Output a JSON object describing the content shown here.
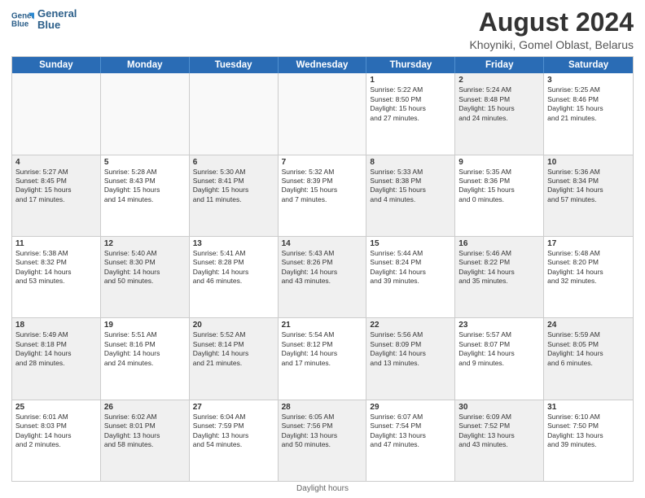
{
  "header": {
    "logo_line1": "General",
    "logo_line2": "Blue",
    "main_title": "August 2024",
    "subtitle": "Khoyniki, Gomel Oblast, Belarus"
  },
  "days_of_week": [
    "Sunday",
    "Monday",
    "Tuesday",
    "Wednesday",
    "Thursday",
    "Friday",
    "Saturday"
  ],
  "weeks": [
    [
      {
        "day": "",
        "info": "",
        "empty": true
      },
      {
        "day": "",
        "info": "",
        "empty": true
      },
      {
        "day": "",
        "info": "",
        "empty": true
      },
      {
        "day": "",
        "info": "",
        "empty": true
      },
      {
        "day": "1",
        "info": "Sunrise: 5:22 AM\nSunset: 8:50 PM\nDaylight: 15 hours\nand 27 minutes."
      },
      {
        "day": "2",
        "info": "Sunrise: 5:24 AM\nSunset: 8:48 PM\nDaylight: 15 hours\nand 24 minutes.",
        "shaded": true
      },
      {
        "day": "3",
        "info": "Sunrise: 5:25 AM\nSunset: 8:46 PM\nDaylight: 15 hours\nand 21 minutes."
      }
    ],
    [
      {
        "day": "4",
        "info": "Sunrise: 5:27 AM\nSunset: 8:45 PM\nDaylight: 15 hours\nand 17 minutes.",
        "shaded": true
      },
      {
        "day": "5",
        "info": "Sunrise: 5:28 AM\nSunset: 8:43 PM\nDaylight: 15 hours\nand 14 minutes."
      },
      {
        "day": "6",
        "info": "Sunrise: 5:30 AM\nSunset: 8:41 PM\nDaylight: 15 hours\nand 11 minutes.",
        "shaded": true
      },
      {
        "day": "7",
        "info": "Sunrise: 5:32 AM\nSunset: 8:39 PM\nDaylight: 15 hours\nand 7 minutes."
      },
      {
        "day": "8",
        "info": "Sunrise: 5:33 AM\nSunset: 8:38 PM\nDaylight: 15 hours\nand 4 minutes.",
        "shaded": true
      },
      {
        "day": "9",
        "info": "Sunrise: 5:35 AM\nSunset: 8:36 PM\nDaylight: 15 hours\nand 0 minutes."
      },
      {
        "day": "10",
        "info": "Sunrise: 5:36 AM\nSunset: 8:34 PM\nDaylight: 14 hours\nand 57 minutes.",
        "shaded": true
      }
    ],
    [
      {
        "day": "11",
        "info": "Sunrise: 5:38 AM\nSunset: 8:32 PM\nDaylight: 14 hours\nand 53 minutes."
      },
      {
        "day": "12",
        "info": "Sunrise: 5:40 AM\nSunset: 8:30 PM\nDaylight: 14 hours\nand 50 minutes.",
        "shaded": true
      },
      {
        "day": "13",
        "info": "Sunrise: 5:41 AM\nSunset: 8:28 PM\nDaylight: 14 hours\nand 46 minutes."
      },
      {
        "day": "14",
        "info": "Sunrise: 5:43 AM\nSunset: 8:26 PM\nDaylight: 14 hours\nand 43 minutes.",
        "shaded": true
      },
      {
        "day": "15",
        "info": "Sunrise: 5:44 AM\nSunset: 8:24 PM\nDaylight: 14 hours\nand 39 minutes."
      },
      {
        "day": "16",
        "info": "Sunrise: 5:46 AM\nSunset: 8:22 PM\nDaylight: 14 hours\nand 35 minutes.",
        "shaded": true
      },
      {
        "day": "17",
        "info": "Sunrise: 5:48 AM\nSunset: 8:20 PM\nDaylight: 14 hours\nand 32 minutes."
      }
    ],
    [
      {
        "day": "18",
        "info": "Sunrise: 5:49 AM\nSunset: 8:18 PM\nDaylight: 14 hours\nand 28 minutes.",
        "shaded": true
      },
      {
        "day": "19",
        "info": "Sunrise: 5:51 AM\nSunset: 8:16 PM\nDaylight: 14 hours\nand 24 minutes."
      },
      {
        "day": "20",
        "info": "Sunrise: 5:52 AM\nSunset: 8:14 PM\nDaylight: 14 hours\nand 21 minutes.",
        "shaded": true
      },
      {
        "day": "21",
        "info": "Sunrise: 5:54 AM\nSunset: 8:12 PM\nDaylight: 14 hours\nand 17 minutes."
      },
      {
        "day": "22",
        "info": "Sunrise: 5:56 AM\nSunset: 8:09 PM\nDaylight: 14 hours\nand 13 minutes.",
        "shaded": true
      },
      {
        "day": "23",
        "info": "Sunrise: 5:57 AM\nSunset: 8:07 PM\nDaylight: 14 hours\nand 9 minutes."
      },
      {
        "day": "24",
        "info": "Sunrise: 5:59 AM\nSunset: 8:05 PM\nDaylight: 14 hours\nand 6 minutes.",
        "shaded": true
      }
    ],
    [
      {
        "day": "25",
        "info": "Sunrise: 6:01 AM\nSunset: 8:03 PM\nDaylight: 14 hours\nand 2 minutes."
      },
      {
        "day": "26",
        "info": "Sunrise: 6:02 AM\nSunset: 8:01 PM\nDaylight: 13 hours\nand 58 minutes.",
        "shaded": true
      },
      {
        "day": "27",
        "info": "Sunrise: 6:04 AM\nSunset: 7:59 PM\nDaylight: 13 hours\nand 54 minutes."
      },
      {
        "day": "28",
        "info": "Sunrise: 6:05 AM\nSunset: 7:56 PM\nDaylight: 13 hours\nand 50 minutes.",
        "shaded": true
      },
      {
        "day": "29",
        "info": "Sunrise: 6:07 AM\nSunset: 7:54 PM\nDaylight: 13 hours\nand 47 minutes."
      },
      {
        "day": "30",
        "info": "Sunrise: 6:09 AM\nSunset: 7:52 PM\nDaylight: 13 hours\nand 43 minutes.",
        "shaded": true
      },
      {
        "day": "31",
        "info": "Sunrise: 6:10 AM\nSunset: 7:50 PM\nDaylight: 13 hours\nand 39 minutes."
      }
    ]
  ],
  "footer": {
    "note": "Daylight hours"
  }
}
